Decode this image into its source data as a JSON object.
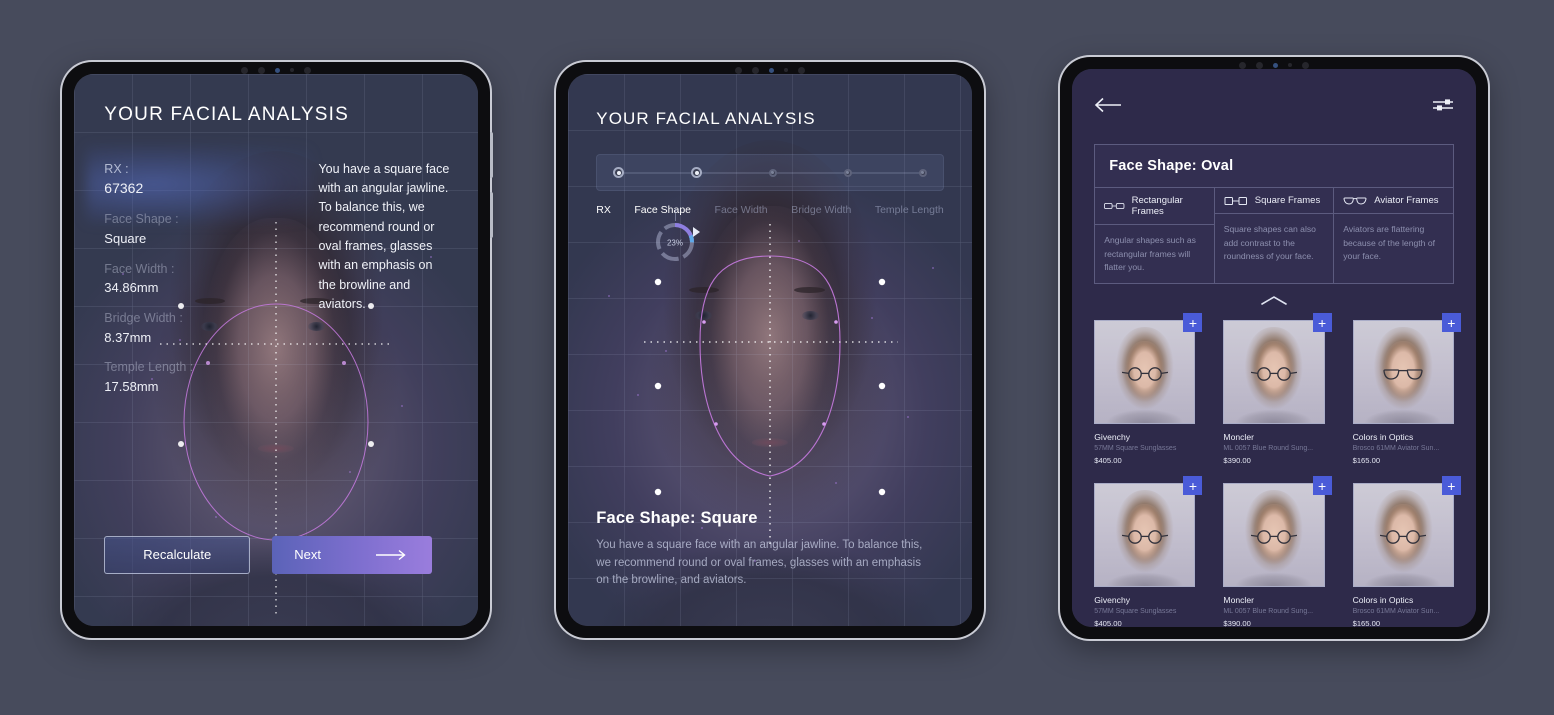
{
  "panel1": {
    "title": "YOUR FACIAL ANALYSIS",
    "metrics": [
      {
        "key": "RX :",
        "value": "67362"
      },
      {
        "key": "Face Shape :",
        "value": "Square"
      },
      {
        "key": "Face Width :",
        "value": "34.86mm"
      },
      {
        "key": "Bridge Width :",
        "value": "8.37mm"
      },
      {
        "key": "Temple Length :",
        "value": "17.58mm"
      }
    ],
    "description": "You have a square face with an angular jawline. To balance this, we recommend round or oval frames, glasses with an emphasis on the browline and aviators.",
    "recalculate_label": "Recalculate",
    "next_label": "Next"
  },
  "panel2": {
    "title": "YOUR FACIAL ANALYSIS",
    "steps": [
      {
        "label": "RX",
        "state": "done"
      },
      {
        "label": "Face Shape",
        "state": "active"
      },
      {
        "label": "Face Width",
        "state": "todo"
      },
      {
        "label": "Bridge Width",
        "state": "todo"
      },
      {
        "label": "Temple Length",
        "state": "todo"
      }
    ],
    "progress_value": "23%",
    "progress_percent": 23,
    "result_title": "Face Shape: Square",
    "result_description": "You have a square face with an angular jawline. To balance this, we recommend round or oval frames, glasses with an emphasis on the browline, and aviators."
  },
  "panel3": {
    "back_icon": "arrow-left-icon",
    "settings_icon": "sliders-icon",
    "shape_title": "Face Shape: Oval",
    "frame_columns": [
      {
        "icon": "rectangular-frames-icon",
        "label": "Rectangular Frames",
        "text": "Angular shapes such as rectangular frames will flatter you."
      },
      {
        "icon": "square-frames-icon",
        "label": "Square Frames",
        "text": "Square shapes can also add contrast to the roundness of your face."
      },
      {
        "icon": "aviator-frames-icon",
        "label": "Aviator Frames",
        "text": "Aviators are flattering because of the length of your face."
      }
    ],
    "collapse_icon": "chevron-up-icon",
    "add_label": "+",
    "products": [
      {
        "brand": "Givenchy",
        "model": "57MM Square Sunglasses",
        "price": "$405.00",
        "style": "round"
      },
      {
        "brand": "Moncler",
        "model": "ML 0057 Blue Round Sung...",
        "price": "$390.00",
        "style": "round"
      },
      {
        "brand": "Colors in Optics",
        "model": "Brosco 61MM Aviator Sun...",
        "price": "$165.00",
        "style": "aviator"
      },
      {
        "brand": "Givenchy",
        "model": "57MM Square Sunglasses",
        "price": "$405.00",
        "style": "round"
      },
      {
        "brand": "Moncler",
        "model": "ML 0057 Blue Round Sung...",
        "price": "$390.00",
        "style": "round"
      },
      {
        "brand": "Colors in Optics",
        "model": "Brosco 61MM Aviator Sun...",
        "price": "$165.00",
        "style": "round"
      }
    ]
  },
  "theme": {
    "page_background": "#474b5c",
    "accent_blue": "#4a5bd8",
    "accent_purple": "#9a7ddd",
    "panel3_background": "#2e2a4a",
    "overlay_magenta": "#c77ae0"
  }
}
